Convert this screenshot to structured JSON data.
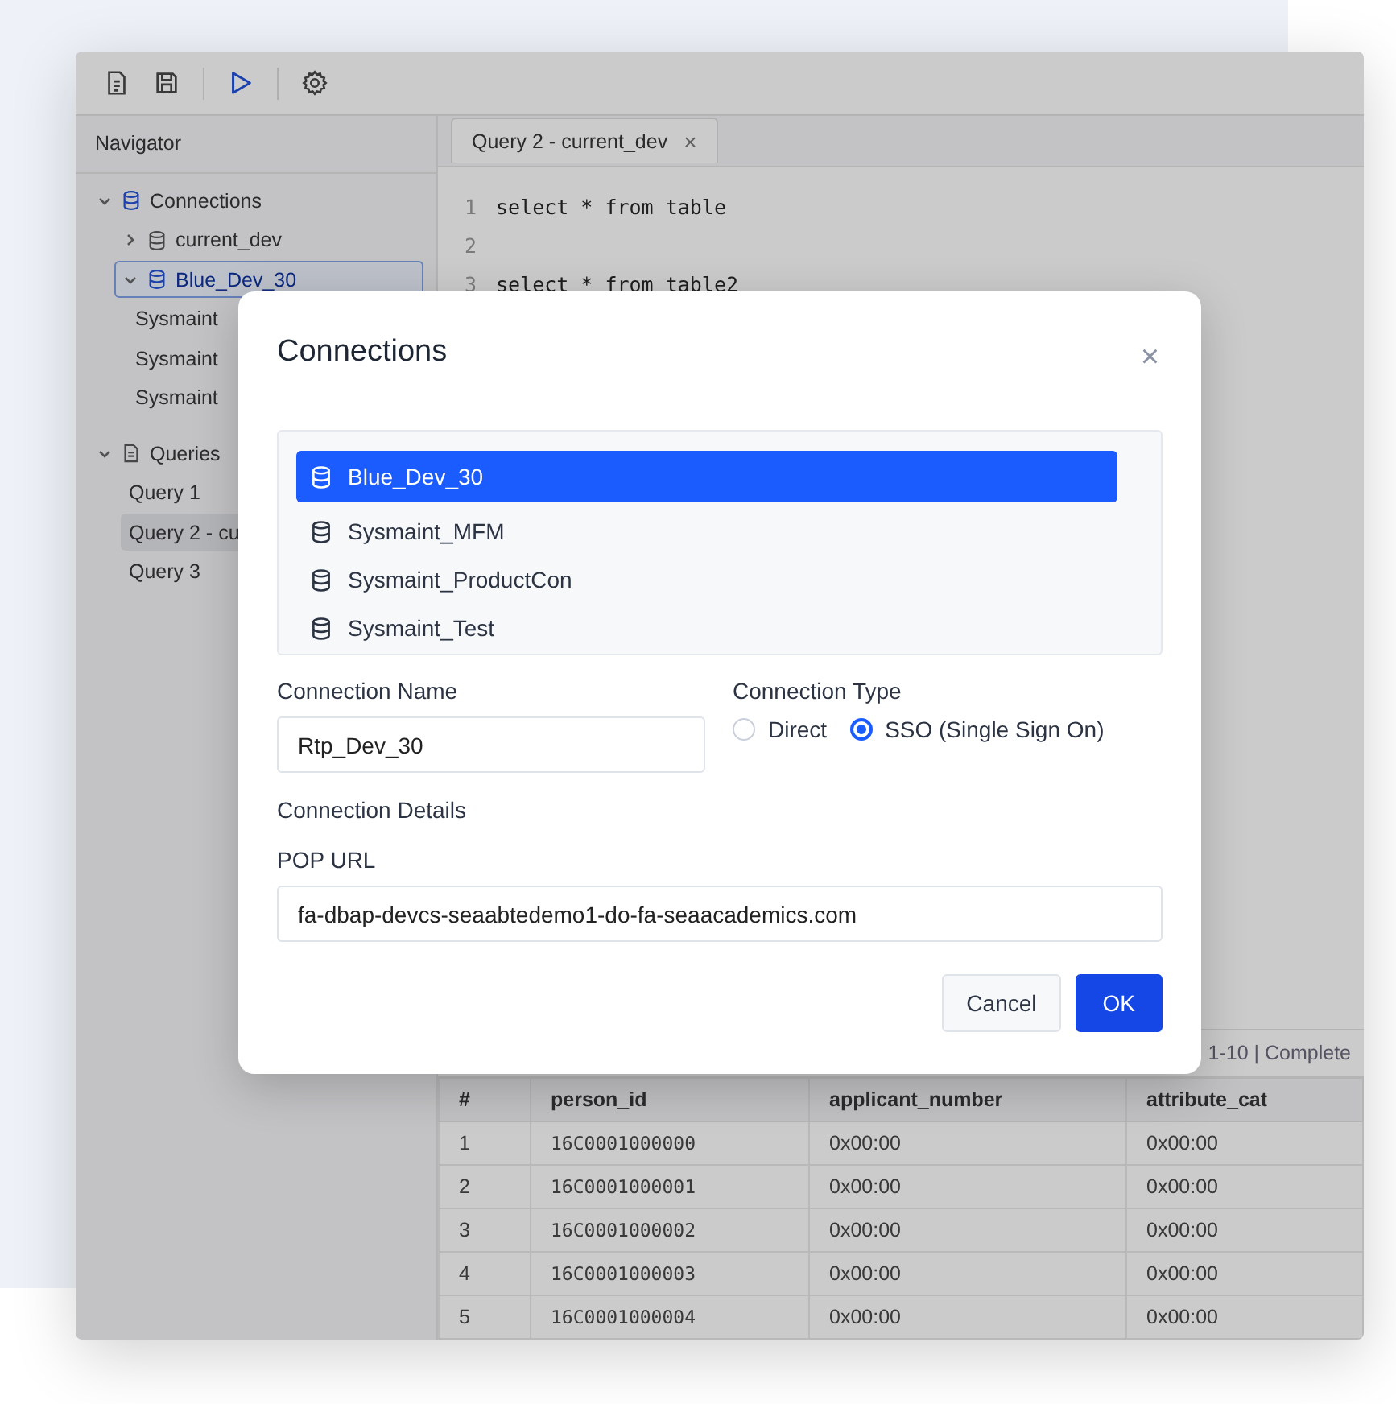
{
  "navigator": {
    "title": "Navigator",
    "tree": [
      {
        "label": "Connections",
        "kind": "database",
        "expanded": true,
        "selected": false,
        "children": [
          {
            "label": "current_dev",
            "kind": "database",
            "expanded": false,
            "selected": false
          },
          {
            "label": "Blue_Dev_30",
            "kind": "database",
            "expanded": true,
            "selected": true,
            "children": [
              {
                "label": "Sysmaint",
                "kind": "leaf",
                "selected": false
              },
              {
                "label": "Sysmaint",
                "kind": "leaf",
                "selected": false
              },
              {
                "label": "Sysmaint",
                "kind": "leaf",
                "selected": false
              }
            ]
          }
        ]
      },
      {
        "label": "Queries",
        "kind": "document",
        "expanded": true,
        "selected": false,
        "children": [
          {
            "label": "Query 1",
            "kind": "leaf",
            "selected": false
          },
          {
            "label": "Query 2 - cu",
            "kind": "leaf",
            "selected": true
          },
          {
            "label": "Query 3",
            "kind": "leaf",
            "selected": false
          }
        ]
      }
    ]
  },
  "editor": {
    "tabs": [
      {
        "label": "Query 2 - current_dev",
        "selected": true,
        "close": "×"
      }
    ],
    "lines": [
      {
        "number": "1",
        "code": "select * from table"
      },
      {
        "number": "2"
      },
      {
        "number": "3",
        "code": "select * from table2"
      }
    ]
  },
  "results": {
    "status": "1-10 | Complete",
    "columns": [
      "#",
      "person_id",
      "applicant_number",
      "attribute_cat"
    ],
    "rows": [
      [
        "1",
        "16C0001000000",
        "0x00:00",
        "0x00:00"
      ],
      [
        "2",
        "16C0001000001",
        "0x00:00",
        "0x00:00"
      ],
      [
        "3",
        "16C0001000002",
        "0x00:00",
        "0x00:00"
      ],
      [
        "4",
        "16C0001000003",
        "0x00:00",
        "0x00:00"
      ],
      [
        "5",
        "16C0001000004",
        "0x00:00",
        "0x00:00"
      ]
    ]
  },
  "dialog": {
    "title": "Connections",
    "close": "×",
    "connections": [
      {
        "label": "Blue_Dev_30",
        "selected": true
      },
      {
        "label": "Sysmaint_MFM",
        "selected": false
      },
      {
        "label": "Sysmaint_ProductCon",
        "selected": false
      },
      {
        "label": "Sysmaint_Test",
        "selected": false
      }
    ],
    "name_label": "Connection Name",
    "name_value": "Rtp_Dev_30",
    "type_label": "Connection Type",
    "types": [
      {
        "label": "Direct",
        "selected": false
      },
      {
        "label": "SSO (Single Sign On)",
        "selected": true
      }
    ],
    "details_label": "Connection Details",
    "url_label": "POP URL",
    "url_value": "fa-dbap-devcs-seaabtedemo1-do-fa-seaacademics.com",
    "buttons": [
      {
        "label": "Cancel",
        "kind": "secondary"
      },
      {
        "label": "OK",
        "kind": "primary"
      }
    ]
  }
}
